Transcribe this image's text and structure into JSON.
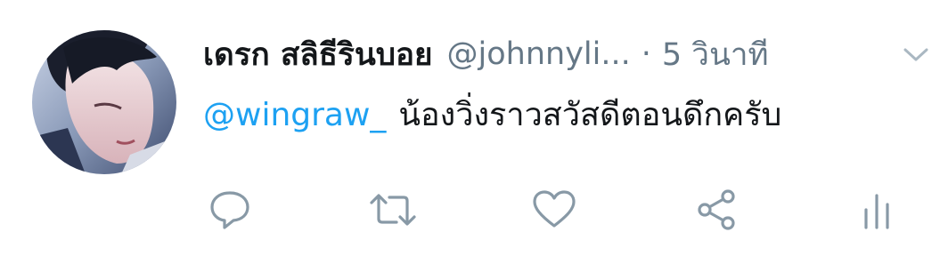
{
  "tweet": {
    "display_name": "เดรก สลิธีรินบอย",
    "handle": "@johnnyli...",
    "separator": "·",
    "time": "5 วินาที",
    "mention": "@wingraw_",
    "body": "น้องวิ่งราวสวัสดีตอนดึกครับ"
  },
  "icons": {
    "menu": "chevron-down-icon",
    "reply": "reply-icon",
    "retweet": "retweet-icon",
    "like": "heart-icon",
    "share": "share-icon",
    "analytics": "analytics-icon"
  },
  "colors": {
    "text": "#14171a",
    "secondary": "#657786",
    "link": "#1da1f2",
    "icon": "#8899a6"
  }
}
